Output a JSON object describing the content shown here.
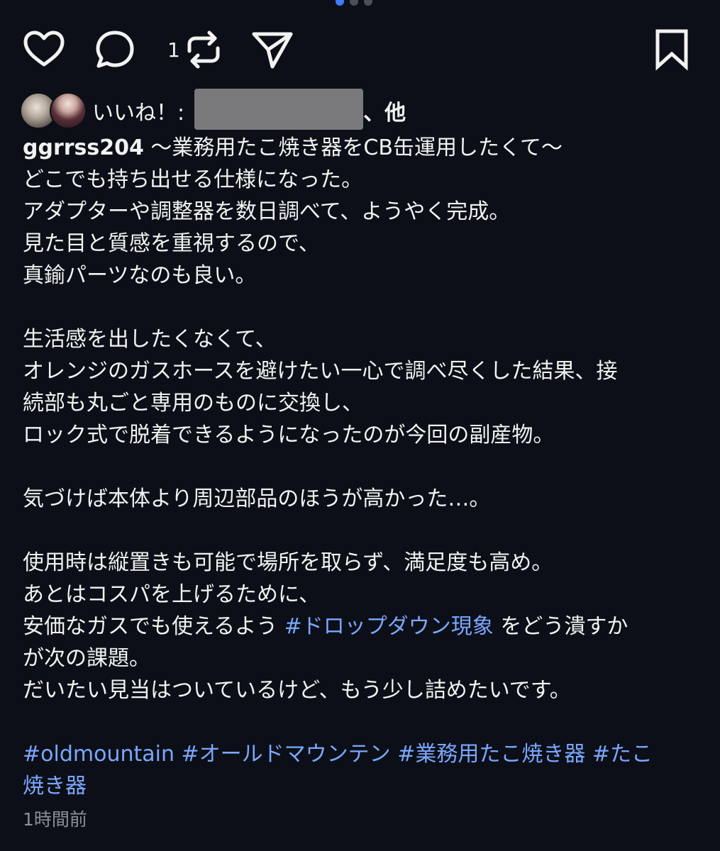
{
  "carousel": {
    "active_index": 0,
    "count": 3
  },
  "actions": {
    "comment_count": "1",
    "icons": [
      "heart-icon",
      "comment-icon",
      "repost-icon",
      "send-icon",
      "bookmark-icon"
    ]
  },
  "likes": {
    "prefix": "いいね！:",
    "suffix": "、他"
  },
  "post": {
    "username": "ggrrss204",
    "caption_first": " 〜業務用たこ焼き器をCB缶運用したくて〜",
    "lines_1": [
      "どこでも持ち出せる仕様になった。",
      "アダプターや調整器を数日調べて、ようやく完成。",
      "見た目と質感を重視するので、",
      "真鍮パーツなのも良い。"
    ],
    "lines_2": [
      "生活感を出したくなくて、",
      "オレンジのガスホースを避けたい一心で調べ尽くした結果、接",
      "続部も丸ごと専用のものに交換し、",
      "ロック式で脱着できるようになったのが今回の副産物。"
    ],
    "lines_3": [
      "気づけば本体より周辺部品のほうが高かった…。"
    ],
    "lines_4a": [
      "使用時は縦置きも可能で場所を取らず、満足度も高め。",
      "あとはコスパを上げるために、"
    ],
    "inline_before": "安価なガスでも使えるよう ",
    "inline_hashtag": "#ドロップダウン現象",
    "inline_after": " をどう潰すか",
    "lines_4b": [
      "が次の課題。",
      "だいたい見当はついているけど、もう少し詰めたいです。"
    ],
    "tags_line1": [
      "#oldmountain",
      "#オールドマウンテン",
      "#業務用たこ焼き器",
      "#たこ"
    ],
    "tags_line2": "焼き器",
    "timestamp": "1時間前"
  },
  "colors": {
    "background": "#0c0f17",
    "text": "#f2f2f2",
    "hashtag": "#7aa7ff",
    "muted": "#8c8f96",
    "dot_active": "#3f7cf5"
  }
}
